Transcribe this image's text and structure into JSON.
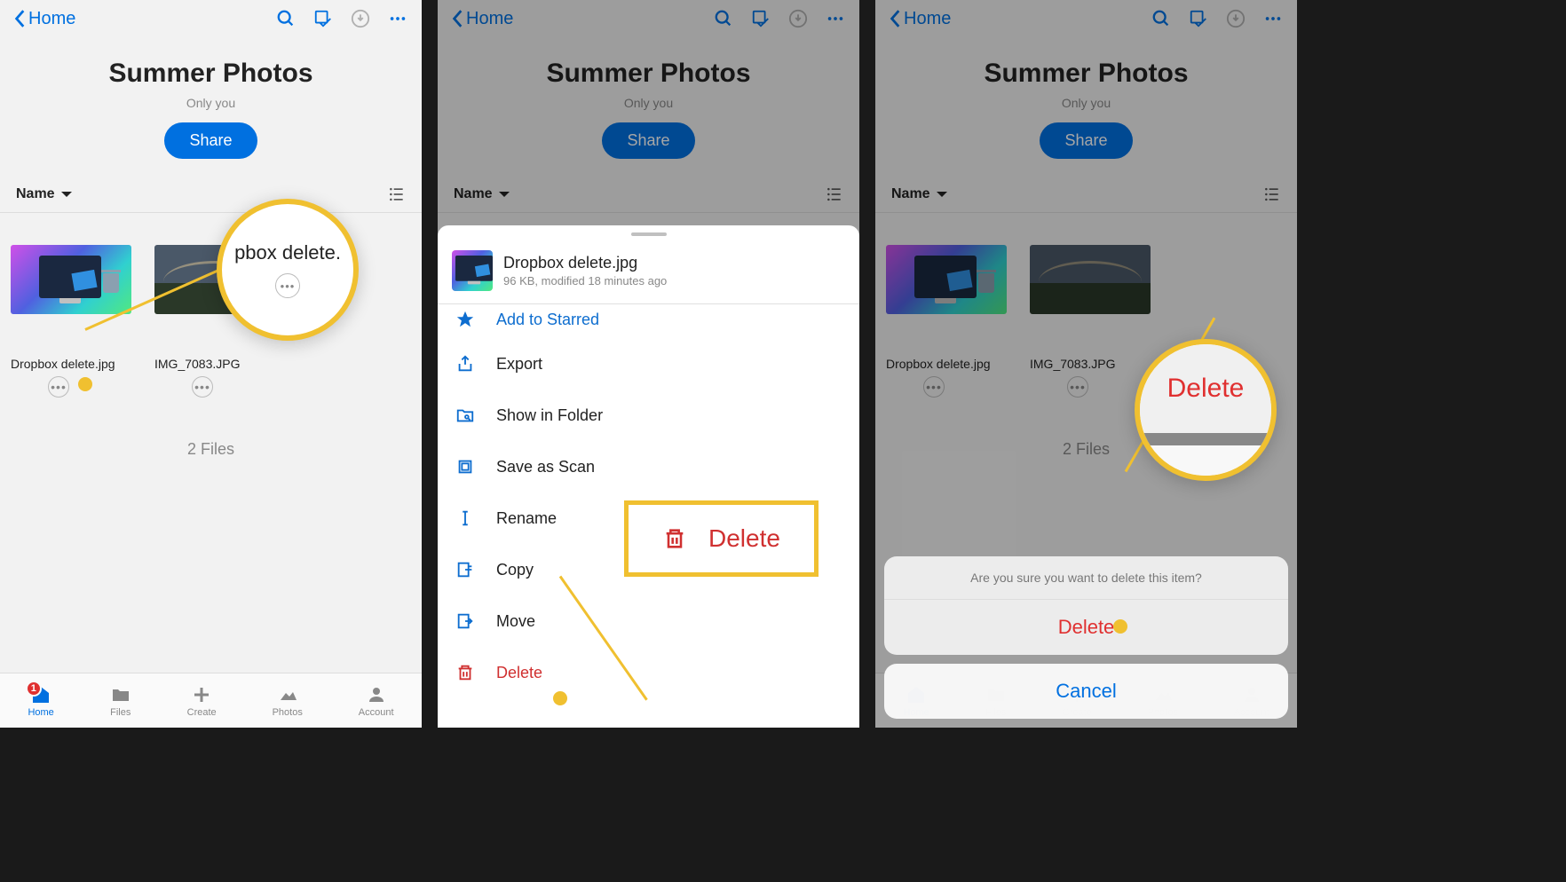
{
  "header": {
    "back_label": "Home"
  },
  "folder": {
    "title": "Summer Photos",
    "subtitle": "Only you",
    "share_label": "Share"
  },
  "list": {
    "sort_label": "Name"
  },
  "files": {
    "file1_name": "Dropbox delete.jpg",
    "file2_name": "IMG_7083.JPG",
    "count_label": "2 Files"
  },
  "tabs": {
    "home": "Home",
    "files": "Files",
    "create": "Create",
    "photos": "Photos",
    "account": "Account",
    "badge": "1"
  },
  "sheet": {
    "file_name": "Dropbox delete.jpg",
    "file_meta": "96 KB, modified 18 minutes ago",
    "starred": "Add to Starred",
    "export": "Export",
    "show_folder": "Show in Folder",
    "save_scan": "Save as Scan",
    "rename": "Rename",
    "copy": "Copy",
    "move": "Move",
    "delete": "Delete"
  },
  "callout": {
    "delete": "Delete",
    "zoom_file": "pbox delete.",
    "ellipsis": "•••"
  },
  "confirm": {
    "message": "Are you sure you want to delete this item?",
    "delete": "Delete",
    "cancel": "Cancel"
  }
}
